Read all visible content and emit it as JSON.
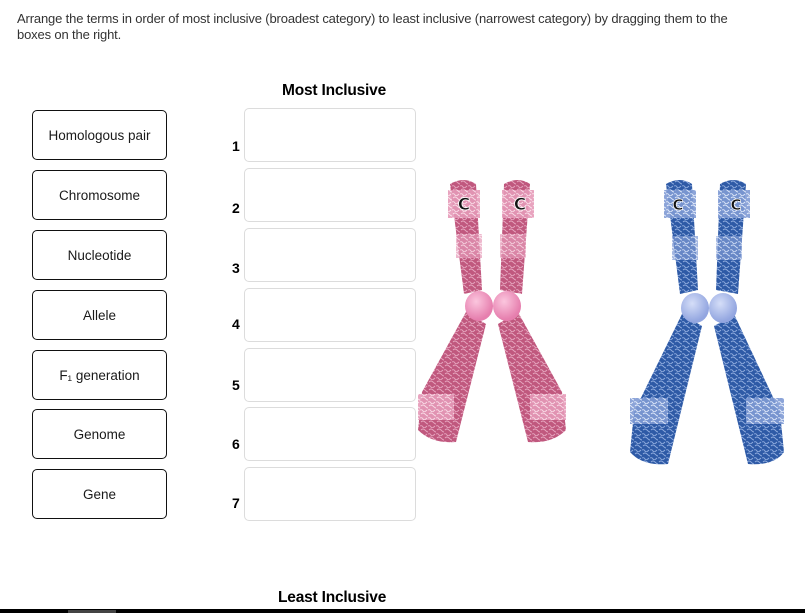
{
  "instructions": "Arrange the terms in order of most inclusive (broadest category) to least inclusive (narrowest category) by dragging them to the boxes on the right.",
  "terms": [
    {
      "label": "Homologous pair"
    },
    {
      "label": "Chromosome"
    },
    {
      "label": "Nucleotide"
    },
    {
      "label": "Allele"
    },
    {
      "label": "F₁ generation"
    },
    {
      "label": "Genome"
    },
    {
      "label": "Gene"
    }
  ],
  "ranking": {
    "top_label": "Most Inclusive",
    "bottom_label": "Least Inclusive",
    "slots": [
      {
        "number": "1",
        "value": ""
      },
      {
        "number": "2",
        "value": ""
      },
      {
        "number": "3",
        "value": ""
      },
      {
        "number": "4",
        "value": ""
      },
      {
        "number": "5",
        "value": ""
      },
      {
        "number": "6",
        "value": ""
      },
      {
        "number": "7",
        "value": ""
      }
    ]
  },
  "figures": [
    {
      "name": "pink-chromosome",
      "color": "#c0587e",
      "light": "#eaa6c0",
      "centromere": "#f29ac0",
      "labels": [
        "C",
        "C"
      ]
    },
    {
      "name": "blue-chromosome",
      "color": "#2f5ea8",
      "light": "#8ea8dc",
      "centromere": "#a9b9ea",
      "labels": [
        "C",
        "C"
      ]
    }
  ]
}
